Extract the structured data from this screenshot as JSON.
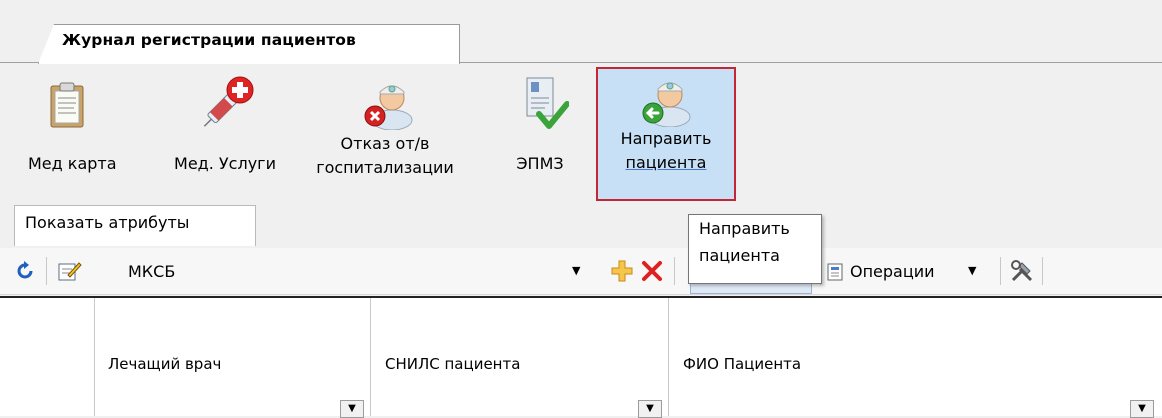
{
  "tabs": {
    "document_tab": "Журнал регистрации пациентов",
    "attributes_tab": "Показать атрибуты"
  },
  "ribbon": {
    "buttons": [
      {
        "label1": "Мед карта",
        "label2": "",
        "icon": "clipboard-icon"
      },
      {
        "label1": "Мед. Услуги",
        "label2": "",
        "icon": "syringe-icon"
      },
      {
        "label1": "Отказ от/в",
        "label2": "госпитализации",
        "icon": "doctor-refuse-icon"
      },
      {
        "label1": "ЭПМЗ",
        "label2": "",
        "icon": "document-check-icon"
      },
      {
        "label1": "Направить",
        "label2": "пациента",
        "icon": "doctor-direct-icon",
        "selected": true
      }
    ]
  },
  "tooltip": {
    "line1": "Направить",
    "line2": "пациента"
  },
  "toolbar": {
    "filter_value": "МКСБ",
    "operations_label": "Операции"
  },
  "grid": {
    "columns": [
      "Лечащий врач",
      "СНИЛС пациента",
      "ФИО Пациента"
    ]
  },
  "colors": {
    "selected_bg": "#c7e0f6",
    "selected_border": "#c32636",
    "tooltip_border": "#767676"
  }
}
